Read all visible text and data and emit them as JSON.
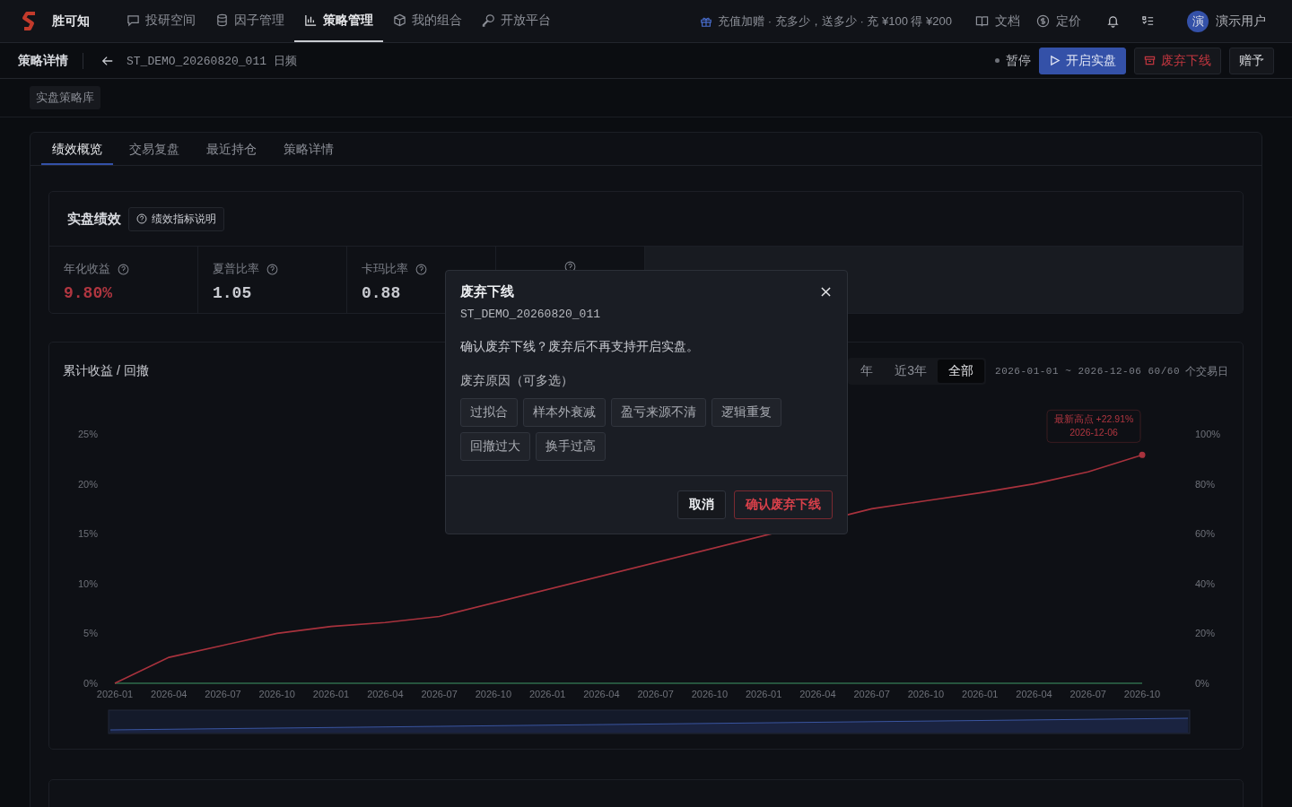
{
  "top_nav": {
    "brand": "胜可知",
    "items": [
      {
        "label": "投研空间",
        "selected": false
      },
      {
        "label": "因子管理",
        "selected": false
      },
      {
        "label": "策略管理",
        "selected": true
      },
      {
        "label": "我的组合",
        "selected": false
      },
      {
        "label": "开放平台",
        "selected": false
      }
    ],
    "promo": "充值加赠 · 充多少，送多少 · 充 ¥100 得 ¥200",
    "links": [
      {
        "label": "文档"
      },
      {
        "label": "定价"
      }
    ],
    "user": {
      "avatar": "演",
      "name": "演示用户"
    }
  },
  "header": {
    "title": "策略详情",
    "strategy": "ST_DEMO_20260820_011 日频",
    "status": "暂停",
    "buttons": [
      {
        "label": "开启实盘",
        "kind": "primary"
      },
      {
        "label": "废弃下线",
        "kind": "danger"
      },
      {
        "label": "赠予",
        "kind": "plain"
      }
    ]
  },
  "library_chip": "实盘策略库",
  "tabs": [
    {
      "label": "绩效概览",
      "selected": true
    },
    {
      "label": "交易复盘",
      "selected": false
    },
    {
      "label": "最近持仓",
      "selected": false
    },
    {
      "label": "策略详情",
      "selected": false
    }
  ],
  "performance": {
    "title": "实盘绩效",
    "help_button": "绩效指标说明",
    "metrics": [
      {
        "label": "年化收益",
        "value": "9.80%",
        "color": "#b03640"
      },
      {
        "label": "夏普比率",
        "value": "1.05",
        "color": "#c8cad0"
      },
      {
        "label": "卡玛比率",
        "value": "0.88",
        "color": "#c8cad0"
      }
    ]
  },
  "chart_card": {
    "title": "累计收益 / 回撤",
    "ranges": [
      {
        "label": "年",
        "selected": false
      },
      {
        "label": "近3年",
        "selected": false
      },
      {
        "label": "全部",
        "selected": true
      }
    ],
    "date_range": "2026-01-01 ~ 2026-12-06 60/60",
    "count_unit": "个交易日",
    "chart_data": {
      "type": "line",
      "categories": [
        "2026-01",
        "2026-04",
        "2026-07",
        "2026-10",
        "2026-01",
        "2026-04",
        "2026-07",
        "2026-10",
        "2026-01",
        "2026-04",
        "2026-07",
        "2026-10",
        "2026-01",
        "2026-04",
        "2026-07",
        "2026-10",
        "2026-01",
        "2026-04",
        "2026-07",
        "2026-10"
      ],
      "series": [
        {
          "color": "#a8323d",
          "values": [
            0,
            2.6,
            3.8,
            5.0,
            5.7,
            6.1,
            6.7,
            null,
            null,
            null,
            null,
            null,
            null,
            null,
            17.5,
            18.3,
            19.1,
            20.0,
            21.2,
            22.9
          ]
        },
        {
          "color": "#2f6b4c",
          "values": [
            0,
            0,
            0,
            0,
            0,
            0,
            0,
            0,
            0,
            0,
            0,
            0,
            0,
            0,
            0,
            0,
            0,
            0,
            0,
            0
          ]
        }
      ],
      "ylim": [
        0,
        25
      ],
      "y2lim": [
        0,
        100
      ],
      "yticks": [
        {
          "value": 0,
          "label": "0%"
        },
        {
          "value": 5,
          "label": "5%"
        },
        {
          "value": 10,
          "label": "10%"
        },
        {
          "value": 15,
          "label": "15%"
        },
        {
          "value": 20,
          "label": "20%"
        },
        {
          "value": 25,
          "label": "25%"
        }
      ],
      "y2ticks": [
        {
          "value": 0,
          "label": "0%"
        },
        {
          "value": 20,
          "label": "20%"
        },
        {
          "value": 40,
          "label": "40%"
        },
        {
          "value": 60,
          "label": "60%"
        },
        {
          "value": 80,
          "label": "80%"
        },
        {
          "value": 100,
          "label": "100%"
        }
      ],
      "annotations": [
        "最新高点 +22.91%",
        "2026-12-06"
      ]
    }
  },
  "dialog": {
    "title": "废弃下线",
    "code": "ST_DEMO_20260820_011",
    "message": "确认废弃下线？废弃后不再支持开启实盘。",
    "reasons_label": "废弃原因（可多选）",
    "reasons": [
      {
        "label": "过拟合",
        "selected": false
      },
      {
        "label": "样本外衰减",
        "selected": false
      },
      {
        "label": "盈亏来源不清",
        "selected": false
      },
      {
        "label": "逻辑重复",
        "selected": false
      },
      {
        "label": "回撤过大",
        "selected": false
      },
      {
        "label": "换手过高",
        "selected": false
      }
    ],
    "buttons": [
      {
        "label": "取消",
        "kind": "cancel"
      },
      {
        "label": "确认废弃下线",
        "kind": "confirm"
      }
    ]
  }
}
